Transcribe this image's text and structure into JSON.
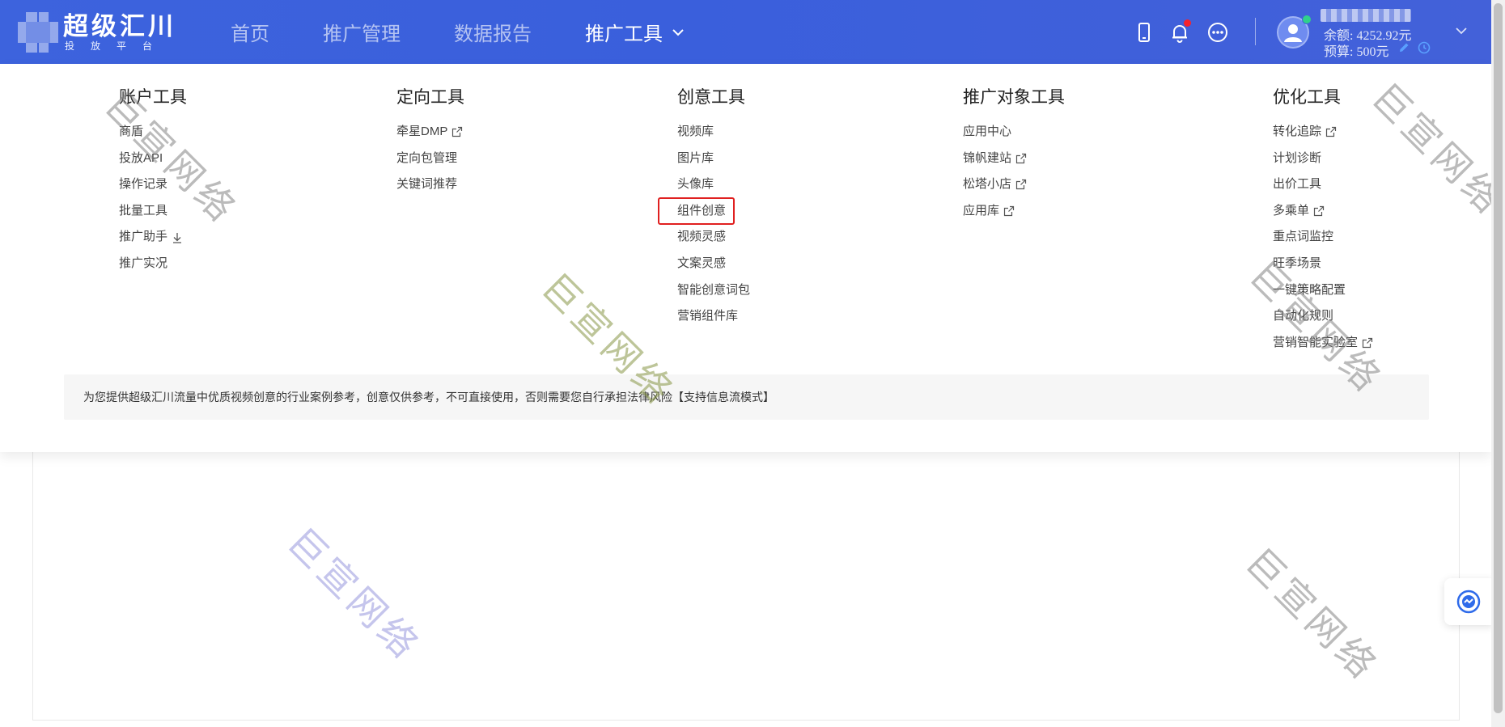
{
  "logo": {
    "title": "超级汇川",
    "subtitle": "投放平台"
  },
  "nav": {
    "items": [
      "首页",
      "推广管理",
      "数据报告",
      "推广工具"
    ],
    "active_index": 3
  },
  "header": {
    "icons": [
      "mobile-icon",
      "bell-icon",
      "more-icon"
    ],
    "account_name_blurred": true,
    "balance": "余额: 4252.92元",
    "budget": "预算: 500元",
    "accent_color": "#3d63dd"
  },
  "menu": {
    "columns": [
      {
        "title": "账户工具",
        "items": [
          {
            "label": "商盾",
            "icon": null
          },
          {
            "label": "投放API",
            "icon": null
          },
          {
            "label": "操作记录",
            "icon": null
          },
          {
            "label": "批量工具",
            "icon": null
          },
          {
            "label": "推广助手",
            "icon": "download-icon"
          },
          {
            "label": "推广实况",
            "icon": null
          }
        ]
      },
      {
        "title": "定向工具",
        "items": [
          {
            "label": "牵星DMP",
            "icon": "external-link-icon"
          },
          {
            "label": "定向包管理",
            "icon": null
          },
          {
            "label": "关键词推荐",
            "icon": null
          }
        ]
      },
      {
        "title": "创意工具",
        "items": [
          {
            "label": "视频库",
            "icon": null
          },
          {
            "label": "图片库",
            "icon": null
          },
          {
            "label": "头像库",
            "icon": null
          },
          {
            "label": "组件创意",
            "icon": null,
            "highlighted": true
          },
          {
            "label": "视频灵感",
            "icon": null
          },
          {
            "label": "文案灵感",
            "icon": null
          },
          {
            "label": "智能创意词包",
            "icon": null
          },
          {
            "label": "营销组件库",
            "icon": null
          }
        ]
      },
      {
        "title": "推广对象工具",
        "items": [
          {
            "label": "应用中心",
            "icon": null
          },
          {
            "label": "锦帆建站",
            "icon": "external-link-icon"
          },
          {
            "label": "松塔小店",
            "icon": "external-link-icon"
          },
          {
            "label": "应用库",
            "icon": "external-link-icon"
          }
        ]
      },
      {
        "title": "优化工具",
        "items": [
          {
            "label": "转化追踪",
            "icon": "external-link-icon"
          },
          {
            "label": "计划诊断",
            "icon": null
          },
          {
            "label": "出价工具",
            "icon": null
          },
          {
            "label": "多乘单",
            "icon": "external-link-icon"
          },
          {
            "label": "重点词监控",
            "icon": null
          },
          {
            "label": "旺季场景",
            "icon": null
          },
          {
            "label": "一键策略配置",
            "icon": null
          },
          {
            "label": "自动化规则",
            "icon": null
          },
          {
            "label": "营销智能实验室",
            "icon": "external-link-icon"
          }
        ]
      }
    ],
    "notice": "为您提供超级汇川流量中优质视频创意的行业案例参考，创意仅供参考，不可直接使用，否则需要您自行承担法律风险【支持信息流模式】"
  },
  "watermark": "巨宣网络",
  "float_button": {
    "icon": "assistant-icon"
  }
}
